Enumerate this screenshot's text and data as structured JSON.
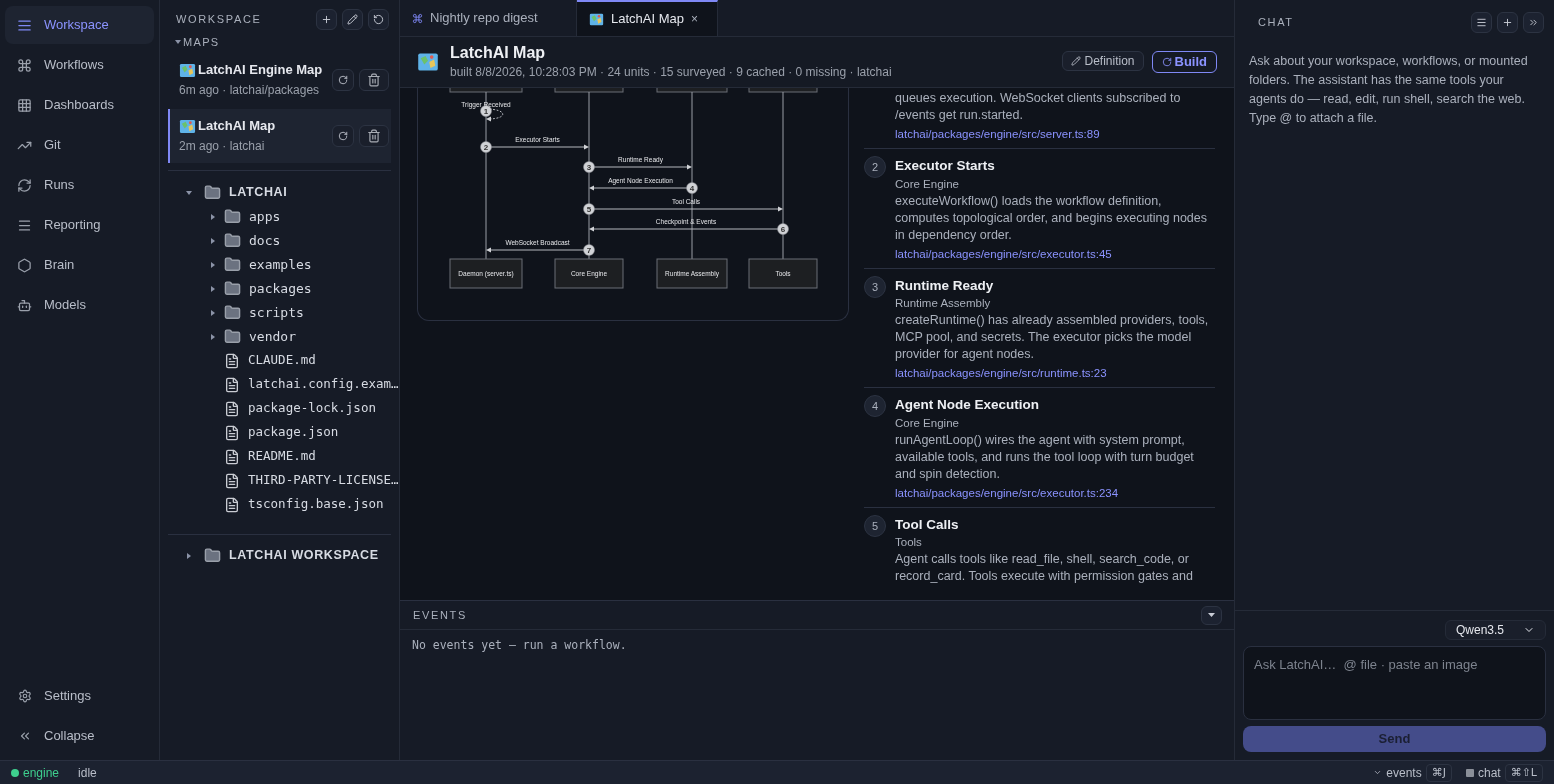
{
  "nav": {
    "items": [
      {
        "label": "Workspace",
        "selected": true
      },
      {
        "label": "Workflows",
        "selected": false
      },
      {
        "label": "Dashboards",
        "selected": false
      },
      {
        "label": "Git",
        "selected": false
      },
      {
        "label": "Runs",
        "selected": false
      },
      {
        "label": "Reporting",
        "selected": false
      },
      {
        "label": "Brain",
        "selected": false
      },
      {
        "label": "Models",
        "selected": false
      }
    ],
    "footer": [
      {
        "label": "Settings"
      },
      {
        "label": "Collapse"
      }
    ]
  },
  "workspace": {
    "title": "WORKSPACE",
    "section": "MAPS",
    "section_expanded": true,
    "maps": [
      {
        "title": "LatchAI Engine Map",
        "meta": "6m ago · latchai/packages",
        "selected": false
      },
      {
        "title": "LatchAI Map",
        "meta": "2m ago · latchai",
        "selected": true
      }
    ],
    "tree": [
      {
        "name": "LATCHAI",
        "kind": "root",
        "expanded": true,
        "children": [
          {
            "name": "apps",
            "kind": "folder",
            "expanded": false
          },
          {
            "name": "docs",
            "kind": "folder",
            "expanded": false
          },
          {
            "name": "examples",
            "kind": "folder",
            "expanded": false
          },
          {
            "name": "packages",
            "kind": "folder",
            "expanded": false
          },
          {
            "name": "scripts",
            "kind": "folder",
            "expanded": false
          },
          {
            "name": "vendor",
            "kind": "folder",
            "expanded": false
          },
          {
            "name": "CLAUDE.md",
            "kind": "file"
          },
          {
            "name": "latchai.config.exam…",
            "kind": "file"
          },
          {
            "name": "package-lock.json",
            "kind": "file"
          },
          {
            "name": "package.json",
            "kind": "file"
          },
          {
            "name": "README.md",
            "kind": "file"
          },
          {
            "name": "THIRD-PARTY-LICENSE…",
            "kind": "file"
          },
          {
            "name": "tsconfig.base.json",
            "kind": "file"
          }
        ]
      },
      {
        "name": "LATCHAI WORKSPACE",
        "kind": "root",
        "expanded": false
      }
    ]
  },
  "tabs": [
    {
      "label": "Nightly repo digest",
      "kind": "workflow",
      "selected": false
    },
    {
      "label": "LatchAI Map",
      "kind": "map",
      "selected": true,
      "close": "×"
    }
  ],
  "header": {
    "title": "LatchAI Map",
    "meta": "built 8/8/2026, 10:28:03 PM · 24 units · 15 surveyed · 9 cached · 0 missing · latchai",
    "buttons": [
      {
        "label": "Definition",
        "kind": "secondary"
      },
      {
        "label": "Build",
        "kind": "primary"
      }
    ]
  },
  "diagram": {
    "participants": [
      "Daemon (server.ts)",
      "Core Engine",
      "Runtime Assembly",
      "Tools"
    ],
    "messages": [
      {
        "number": "1",
        "label": "Trigger Received"
      },
      {
        "number": "2",
        "label": "Executor Starts"
      },
      {
        "number": "3",
        "label": "Runtime Ready"
      },
      {
        "number": "4",
        "label": "Agent Node Execution"
      },
      {
        "number": "5",
        "label": "Tool Calls"
      },
      {
        "number": "6",
        "label": "Checkpoint & Events"
      },
      {
        "number": "7",
        "label": "WebSocket Broadcast"
      }
    ]
  },
  "steps": [
    {
      "description": "queues execution. WebSocket clients subscribed to /events get run.started.",
      "link": "latchai/packages/engine/src/server.ts:89"
    },
    {
      "number": "2",
      "title": "Executor Starts",
      "subtitle": "Core Engine",
      "description": "executeWorkflow() loads the workflow definition, computes topological order, and begins executing nodes in dependency order.",
      "link": "latchai/packages/engine/src/executor.ts:45"
    },
    {
      "number": "3",
      "title": "Runtime Ready",
      "subtitle": "Runtime Assembly",
      "description": "createRuntime() has already assembled providers, tools, MCP pool, and secrets. The executor picks the model provider for agent nodes.",
      "link": "latchai/packages/engine/src/runtime.ts:23"
    },
    {
      "number": "4",
      "title": "Agent Node Execution",
      "subtitle": "Core Engine",
      "description": "runAgentLoop() wires the agent with system prompt, available tools, and runs the tool loop with turn budget and spin detection.",
      "link": "latchai/packages/engine/src/executor.ts:234"
    },
    {
      "number": "5",
      "title": "Tool Calls",
      "subtitle": "Tools",
      "description": "Agent calls tools like read_file, shell, search_code, or record_card. Tools execute with permission gates and"
    }
  ],
  "events": {
    "title": "EVENTS",
    "message": "No events yet — run a workflow."
  },
  "chat": {
    "title": "CHAT",
    "intro": "Ask about your workspace, workflows, or mounted folders. The assistant has the same tools your agents do — read, edit, run shell, search the web. Type @ to attach a file.",
    "model": "Qwen3.5",
    "placeholder": "Ask LatchAI…  @ file · paste an image",
    "send": "Send"
  },
  "status_bar": {
    "engine": {
      "label": "engine",
      "online": true
    },
    "state": "idle",
    "shortcuts": [
      {
        "label": "events",
        "keys": "⌘J"
      },
      {
        "label": "chat",
        "keys": "⌘⇧L"
      }
    ]
  }
}
